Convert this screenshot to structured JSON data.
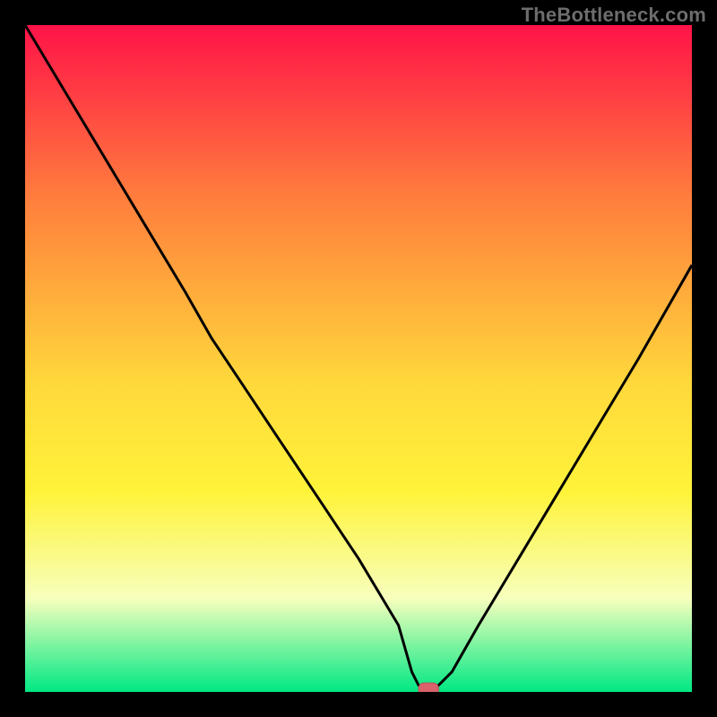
{
  "watermark": "TheBottleneck.com",
  "colors": {
    "frame": "#000000",
    "gradient_top": "#ff1348",
    "gradient_mid1": "#ff7e3d",
    "gradient_mid2": "#ffd93b",
    "gradient_mid3": "#fff33a",
    "gradient_low": "#f7ffbd",
    "gradient_bottom": "#00e884",
    "curve": "#000000",
    "marker_fill": "#d9626b",
    "marker_stroke": "#bb4f57"
  },
  "chart_data": {
    "type": "line",
    "title": "",
    "xlabel": "",
    "ylabel": "",
    "xlim": [
      0,
      100
    ],
    "ylim": [
      0,
      100
    ],
    "series": [
      {
        "name": "bottleneck_curve",
        "x": [
          0,
          6,
          12,
          18,
          24,
          28,
          32,
          38,
          44,
          50,
          56,
          58,
          59,
          61,
          62,
          64,
          68,
          74,
          80,
          86,
          92,
          100
        ],
        "y": [
          100,
          90,
          80,
          70,
          60,
          53,
          47,
          38,
          29,
          20,
          10,
          3,
          1,
          0,
          1,
          3,
          10,
          20,
          30,
          40,
          50,
          64
        ]
      }
    ],
    "marker": {
      "x_start": 59,
      "x_end": 62,
      "y": 0
    },
    "gradient_stops": [
      {
        "offset": 0.0,
        "color": "#ff1348"
      },
      {
        "offset": 0.26,
        "color": "#ff7e3d"
      },
      {
        "offset": 0.54,
        "color": "#ffd93b"
      },
      {
        "offset": 0.7,
        "color": "#fff33a"
      },
      {
        "offset": 0.86,
        "color": "#f7ffbd"
      },
      {
        "offset": 1.0,
        "color": "#00e884"
      }
    ]
  }
}
